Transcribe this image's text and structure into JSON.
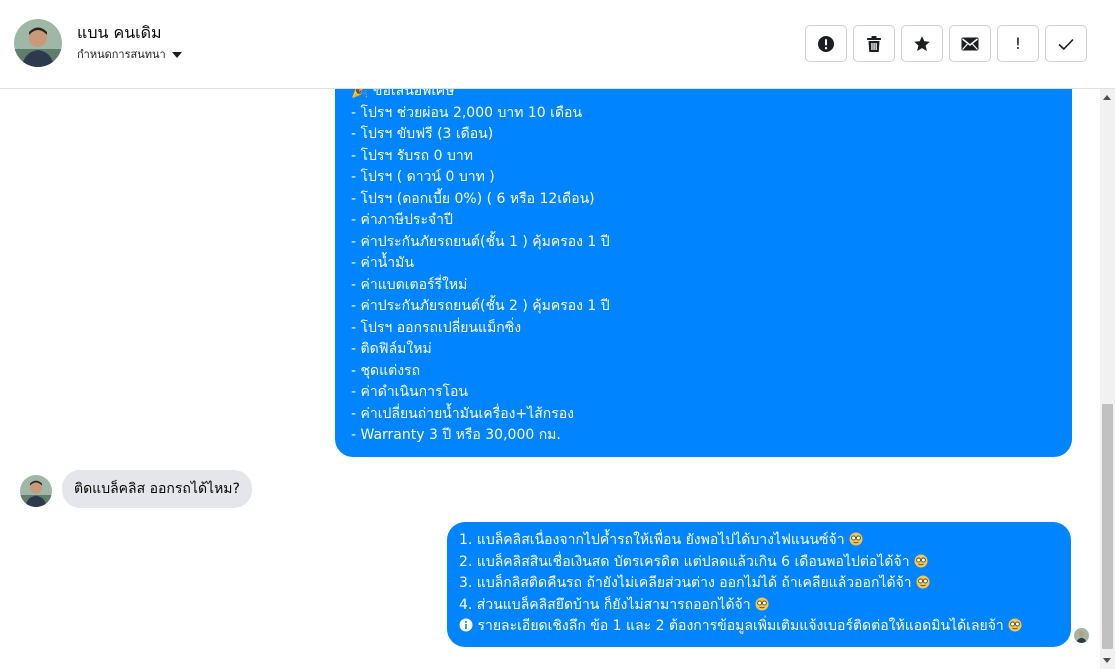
{
  "header": {
    "contact_name": "แบน คนเดิม",
    "subtitle": "กำหนดการสนทนา",
    "avatar_icon": "person-avatar-icon",
    "toolbar": [
      {
        "name": "alert-button",
        "icon": "alert-circle-icon"
      },
      {
        "name": "delete-button",
        "icon": "trash-icon"
      },
      {
        "name": "star-button",
        "icon": "star-icon"
      },
      {
        "name": "mail-button",
        "icon": "envelope-icon"
      },
      {
        "name": "important-button",
        "icon": "exclamation-icon",
        "label": "!"
      },
      {
        "name": "done-button",
        "icon": "checkmark-icon"
      }
    ]
  },
  "messages": {
    "promo_bubble": {
      "header": "🎉 ข้อเสนอพิเศษ",
      "lines": [
        "- โปรฯ ช่วยผ่อน 2,000 บาท 10 เดือน",
        "- โปรฯ ขับฟรี (3 เดือน)",
        "- โปรฯ รับรถ 0 บาท",
        "- โปรฯ ( ดาวน์ 0 บาท )",
        "- โปรฯ (ดอกเบี้ย 0%) ( 6 หรือ 12เดือน)",
        "- ค่าภาษีประจำปี",
        "- ค่าประกันภัยรถยนต์(ชั้น 1 ) คุ้มครอง 1 ปี",
        "- ค่าน้ำมัน",
        "- ค่าแบตเตอร์รี่ใหม่",
        "- ค่าประกันภัยรถยนต์(ชั้น 2 ) คุ้มครอง 1 ปี",
        "- โปรฯ ออกรถเปลี่ยนแม็กซิ่ง",
        "- ติดฟิล์มใหม่",
        "- ชุดแต่งรถ",
        "- ค่าดำเนินการโอน",
        "- ค่าเปลี่ยนถ่ายน้ำมันเครื่อง+ไส้กรอง",
        "- Warranty 3 ปี หรือ 30,000 กม."
      ]
    },
    "incoming": {
      "text": "ติดแบล็คลิส ออกรถได้ไหม?"
    },
    "reply_bubble": {
      "lines": [
        "1. แบล็คลิสเนื่องจากไปค้ำรถให้เพื่อน ยังพอไปได้บางไฟแนนซ์จ้า",
        "2. แบล็คลิสสินเชื่อเงินสด บัตรเครดิต แต่ปลดแล้วเกิน 6 เดือนพอไปต่อได้จ้า",
        "3. แบล็กลิสติดคืนรถ ถ้ายังไม่เคลียส่วนต่าง ออกไม่ได้ ถ้าเคลียแล้วออกได้จ้า",
        "4. ส่วนแบล็คลิสยึดบ้าน ก็ยังไม่สามารถออกได้จ้า",
        "รายละเอียดเชิงลึก ข้อ 1 และ 2 ต้องการข้อมูลเพิ่มเติมแจ้งเบอร์ติดต่อให้แอดมินได้เลยจ้า"
      ],
      "emoji_icon": "nerd-face-icon",
      "info_icon": "info-icon"
    }
  },
  "colors": {
    "bubble_out": "#0084ff",
    "bubble_in": "#e4e6eb",
    "text": "#050505"
  }
}
